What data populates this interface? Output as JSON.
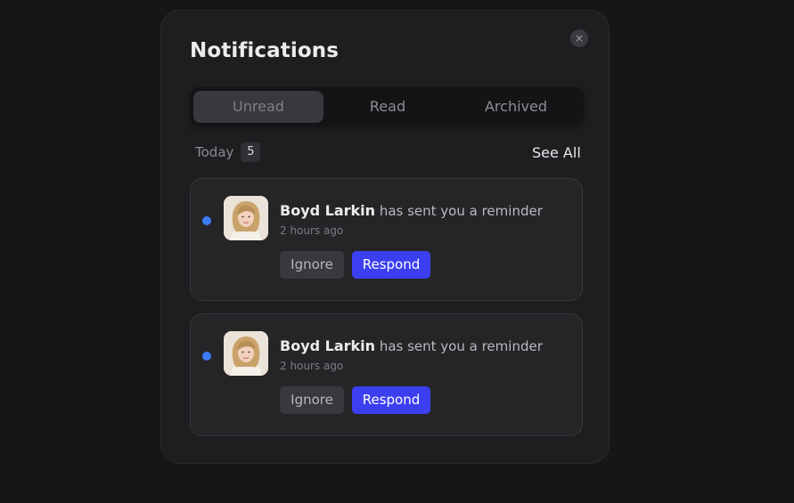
{
  "panel": {
    "title": "Notifications",
    "close_icon": "close-icon",
    "close_glyph": "×"
  },
  "tabs": [
    {
      "label": "Unread",
      "active": true
    },
    {
      "label": "Read",
      "active": false
    },
    {
      "label": "Archived",
      "active": false
    }
  ],
  "section": {
    "label": "Today",
    "count": "5",
    "see_all": "See All"
  },
  "notifications": [
    {
      "name": "Boyd Larkin",
      "message": "has sent you a reminder",
      "time": "2 hours ago",
      "ignore_label": "Ignore",
      "respond_label": "Respond",
      "unread": true
    },
    {
      "name": "Boyd Larkin",
      "message": "has sent you a reminder",
      "time": "2 hours ago",
      "ignore_label": "Ignore",
      "respond_label": "Respond",
      "unread": true
    }
  ],
  "colors": {
    "accent": "#3b3ff0",
    "unread_dot": "#3b7cf4",
    "panel_bg": "#1e1e21",
    "page_bg": "#161618"
  }
}
